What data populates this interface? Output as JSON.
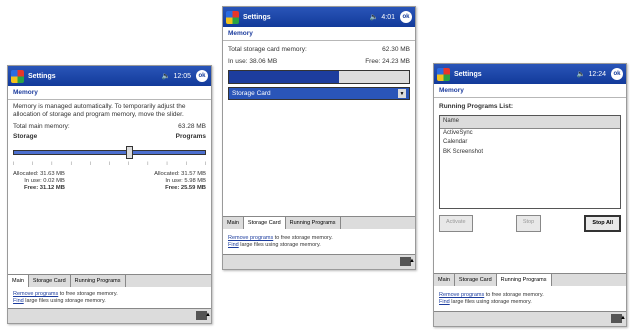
{
  "title": "Settings",
  "clock": {
    "left": "12:05",
    "middle": "4:01",
    "right": "12:24"
  },
  "ok_label": "ok",
  "section_memory": "Memory",
  "left": {
    "note": "Memory is managed automatically. To temporarily adjust the allocation of storage and program memory, move the slider.",
    "total_label": "Total main memory:",
    "total_value": "63.28 MB",
    "storage_label": "Storage",
    "programs_label": "Programs",
    "slider_fraction": 0.6,
    "alloc_storage": "Allocated: 31.63 MB",
    "inuse_storage": "In use:  0.02 MB",
    "free_storage": "Free:  31.12 MB",
    "alloc_programs": "Allocated: 31.57 MB",
    "inuse_programs": "In use:  5.98 MB",
    "free_programs": "Free:  25.59 MB"
  },
  "middle": {
    "total_label": "Total storage card memory:",
    "total_value": "62.30 MB",
    "inuse_label": "In use:",
    "inuse_value": "38.06 MB",
    "free_label": "Free:",
    "free_value": "24.23 MB",
    "bar_fraction": 0.61,
    "select_value": "Storage Card"
  },
  "right": {
    "header": "Running Programs List:",
    "col": "Name",
    "items": [
      "ActiveSync",
      "Calendar",
      "BK Screenshot"
    ],
    "activate": "Activate",
    "stop": "Stop",
    "stop_all": "Stop All"
  },
  "tabs": {
    "main": "Main",
    "storage": "Storage Card",
    "running": "Running Programs"
  },
  "link_remove": "Remove programs",
  "link_remove_rest": " to free storage memory.",
  "link_find": "Find",
  "link_find_rest": " large files using storage memory."
}
